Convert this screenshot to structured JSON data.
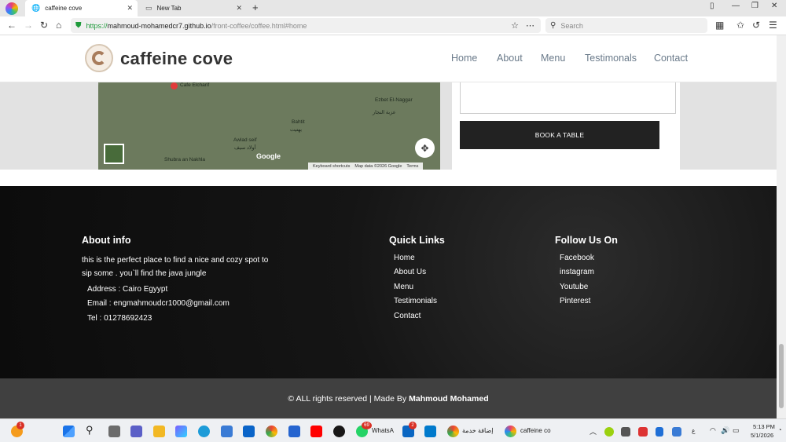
{
  "browser": {
    "tabs": [
      {
        "title": "caffeine cove",
        "icon": "globe-icon"
      },
      {
        "title": "New Tab",
        "icon": "page-icon"
      }
    ],
    "url": {
      "scheme": "https://",
      "host": "mahmoud-mohamedcr7.github.io",
      "path": "/front-coffee/coffee.html#home"
    },
    "search_placeholder": "Search"
  },
  "site": {
    "brand": "caffeine cove",
    "nav": [
      "Home",
      "About",
      "Menu",
      "Testimonals",
      "Contact"
    ]
  },
  "map": {
    "labels": [
      "Cafe Elcharif",
      "Ezbet El-Naggar",
      "عزبة النجار",
      "Bahtit",
      "بهتيت",
      "Awlad seif",
      "أولاد سيف",
      "Shubra an Nakhla"
    ],
    "google": "Google",
    "footer": [
      "Keyboard shortcuts",
      "Map data ©2026 Google",
      "Terms"
    ]
  },
  "form": {
    "book_button": "BOOK A TABLE"
  },
  "footer": {
    "about": {
      "title": "About info",
      "description": [
        "this is the perfect place to find a nice and cozy spot to",
        "sip some . you`ll find the java jungle"
      ],
      "address": "Address : Cairo Egyypt",
      "email": "Email : engmahmoudcr1000@gmail.com",
      "tel": "Tel : 01278692423"
    },
    "quick_links": {
      "title": "Quick Links",
      "items": [
        "Home",
        "About Us",
        "Menu",
        "Testimonials",
        "Contact"
      ]
    },
    "follow": {
      "title": "Follow Us On",
      "items": [
        "Facebook",
        "instagram",
        "Youtube",
        "Pinterest"
      ]
    },
    "copyright_prefix": "© ALL rights reserved | Made By",
    "copyright_author": "Mahmoud Mohamed"
  },
  "taskbar": {
    "apps": [
      {
        "name": "whatsapp",
        "label": "WhatsA",
        "badge": "69"
      },
      {
        "name": "linkedin",
        "badge": "2"
      },
      {
        "name": "chrome-arabic",
        "label": "إضافة خدمة"
      },
      {
        "name": "browser-active",
        "label": "caffeine co"
      }
    ],
    "lang": "ع",
    "time": "5:13 PM",
    "date": "5/1/2026",
    "notification_badge": "1"
  }
}
